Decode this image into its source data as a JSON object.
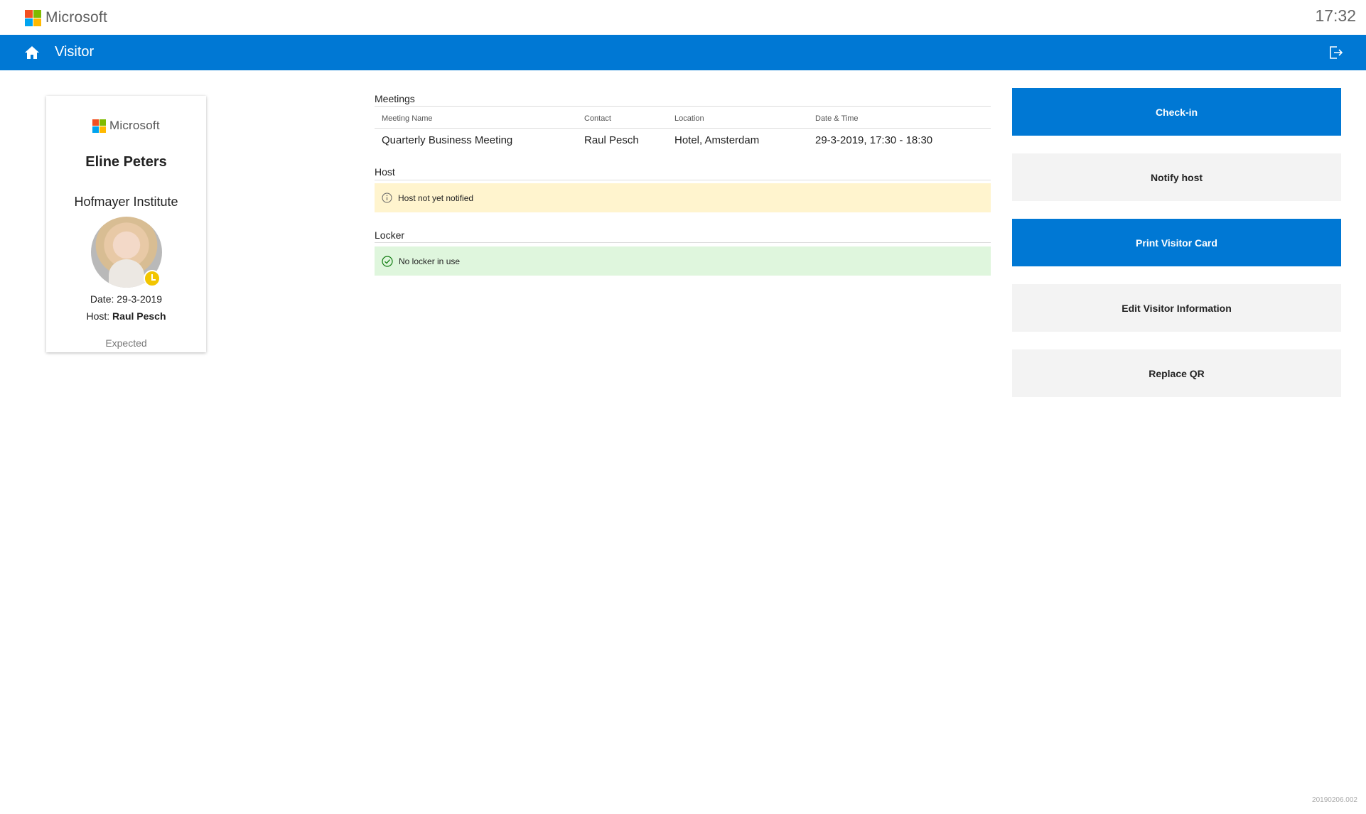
{
  "header": {
    "brand": "Microsoft",
    "clock": "17:32"
  },
  "nav": {
    "title": "Visitor",
    "home_icon": "home-icon",
    "exit_icon": "sign-out-icon"
  },
  "visitor_card": {
    "brand": "Microsoft",
    "name": "Eline Peters",
    "company": "Hofmayer Institute",
    "date_label": "Date: 29-3-2019",
    "host_label": "Host: ",
    "host_name": "Raul Pesch",
    "status": "Expected",
    "status_badge_icon": "clock-icon"
  },
  "meetings": {
    "title": "Meetings",
    "columns": [
      "Meeting Name",
      "Contact",
      "Location",
      "Date & Time"
    ],
    "rows": [
      [
        "Quarterly Business Meeting",
        "Raul Pesch",
        "Hotel, Amsterdam",
        "29-3-2019, 17:30 - 18:30"
      ]
    ]
  },
  "host_section": {
    "title": "Host",
    "message": "Host not yet notified",
    "icon": "info-icon"
  },
  "locker_section": {
    "title": "Locker",
    "message": "No locker in use",
    "icon": "check-circle-icon"
  },
  "actions": {
    "check_in": "Check-in",
    "notify_host": "Notify host",
    "print_card": "Print Visitor Card",
    "edit_info": "Edit Visitor Information",
    "replace_qr": "Replace QR"
  },
  "footer": {
    "version": "20190206.002"
  },
  "colors": {
    "accent": "#0078d4",
    "warning_bg": "#fff4ce",
    "success_bg": "#dff6dd",
    "secondary_button": "#f3f3f3"
  }
}
